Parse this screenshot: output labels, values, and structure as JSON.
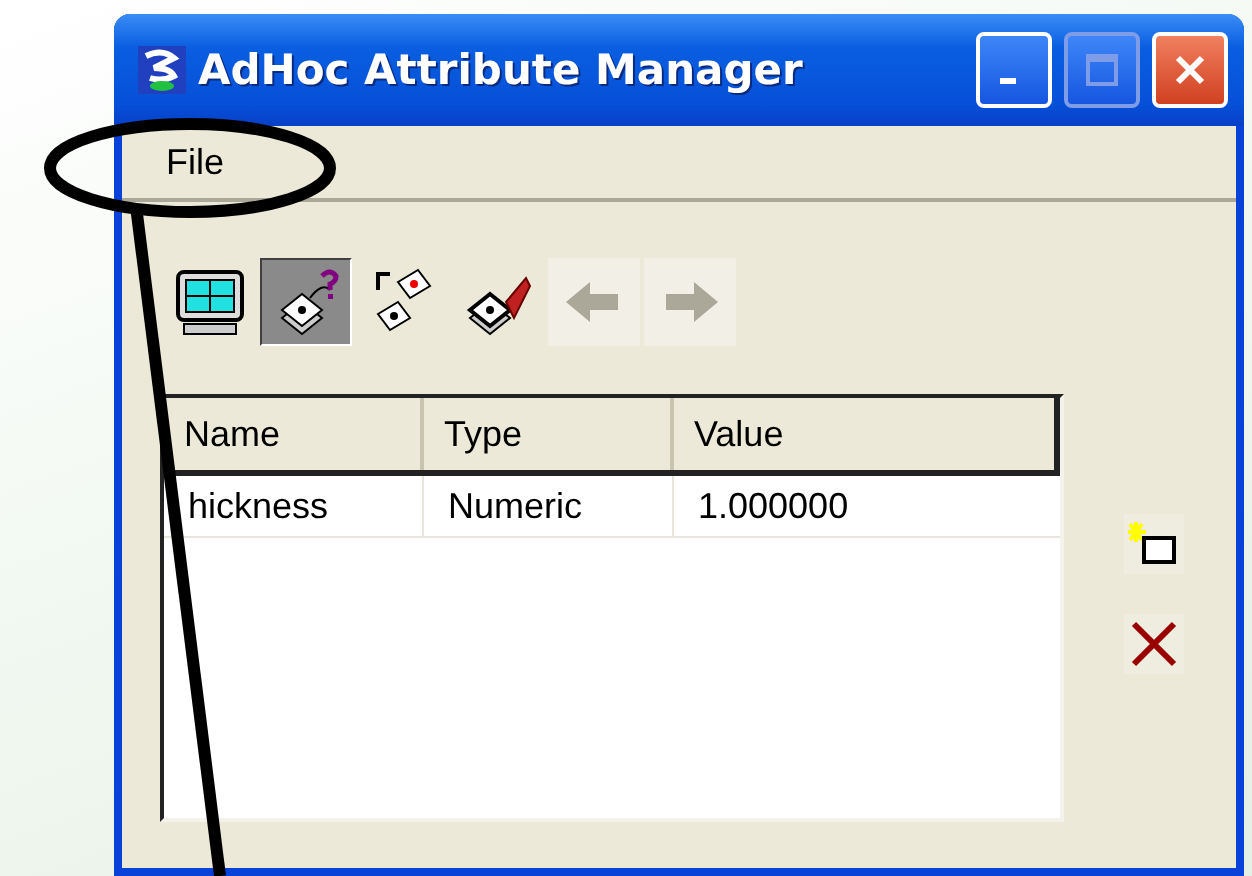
{
  "window": {
    "title": "AdHoc Attribute Manager"
  },
  "menu": [
    {
      "label": "File"
    }
  ],
  "toolbar": [
    {
      "kind": "display",
      "selected": false,
      "disabled": false
    },
    {
      "kind": "query",
      "selected": true,
      "disabled": false
    },
    {
      "kind": "copy",
      "selected": false,
      "disabled": false
    },
    {
      "kind": "remove",
      "selected": false,
      "disabled": false
    },
    {
      "kind": "back",
      "selected": false,
      "disabled": true
    },
    {
      "kind": "forward",
      "selected": false,
      "disabled": true
    }
  ],
  "table": {
    "columns": [
      "Name",
      "Type",
      "Value"
    ],
    "rows": [
      [
        "hickness",
        "Numeric",
        "1.000000"
      ]
    ]
  },
  "side_buttons": [
    {
      "kind": "new"
    },
    {
      "kind": "delete"
    }
  ]
}
